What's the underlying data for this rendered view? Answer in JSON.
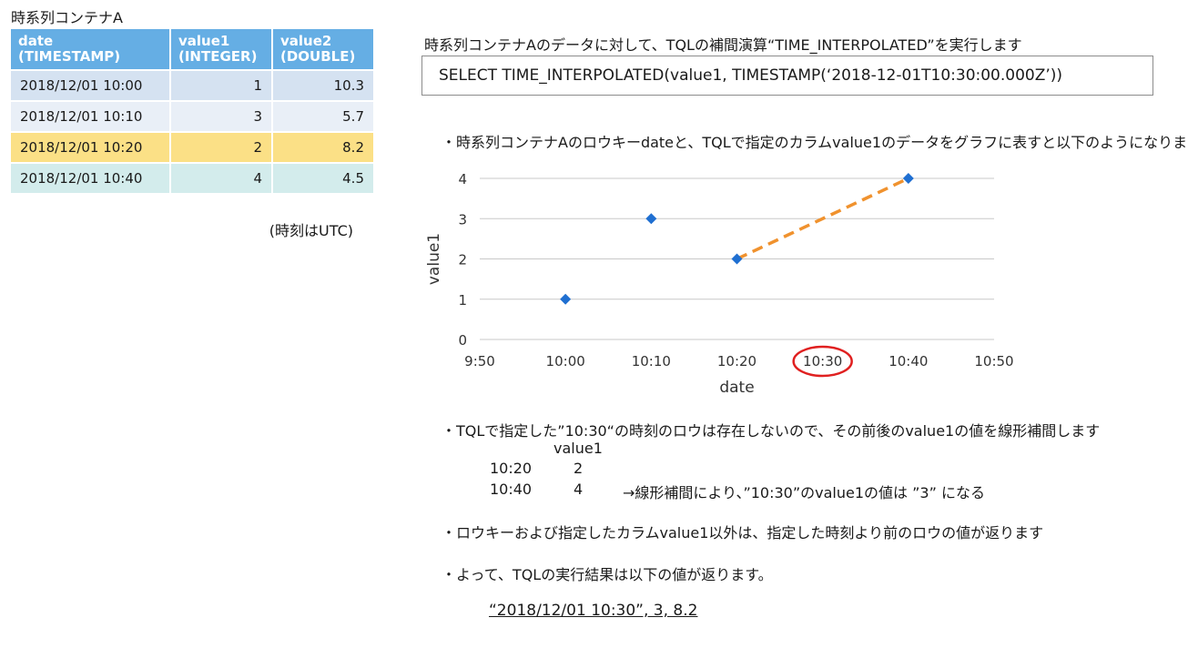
{
  "container": {
    "title": "時系列コンテナA",
    "columns": [
      {
        "name": "date",
        "type": "(TIMESTAMP)"
      },
      {
        "name": "value1",
        "type": "(INTEGER)"
      },
      {
        "name": "value2",
        "type": "(DOUBLE)"
      }
    ],
    "rows": [
      [
        "2018/12/01 10:00",
        "1",
        "10.3"
      ],
      [
        "2018/12/01 10:10",
        "3",
        "5.7"
      ],
      [
        "2018/12/01 10:20",
        "2",
        "8.2"
      ],
      [
        "2018/12/01 10:40",
        "4",
        "4.5"
      ]
    ],
    "timezone_note": "(時刻はUTC)"
  },
  "intro_text": "時系列コンテナAのデータに対して、TQLの補間演算“TIME_INTERPOLATED”を実行します",
  "query": "SELECT TIME_INTERPOLATED(value1, TIMESTAMP(‘2018-12-01T10:30:00.000Z’))",
  "bullets": {
    "graph": "・時系列コンテナAのロウキーdateと、TQLで指定のカラムvalue1のデータをグラフに表すと以下のようになります",
    "missing": "・TQLで指定した”10:30“の時刻のロウは存在しないので、その前後のvalue1の値を線形補間します",
    "others": "・ロウキーおよび指定したカラムvalue1以外は、指定した時刻より前のロウの値が返ります",
    "result": "・よって、TQLの実行結果は以下の値が返ります。"
  },
  "interpolation": {
    "header": "value1",
    "rows": [
      {
        "time": "10:20",
        "value": "2"
      },
      {
        "time": "10:40",
        "value": "4"
      }
    ],
    "note": "→線形補間により、”10:30”のvalue1の値は ”3” になる"
  },
  "result_value": "“2018/12/01 10:30”, 3, 8.2",
  "chart_data": {
    "type": "scatter",
    "xlabel": "date",
    "ylabel": "value1",
    "x_ticks": [
      "9:50",
      "10:00",
      "10:10",
      "10:20",
      "10:30",
      "10:40",
      "10:50"
    ],
    "x_tick_minutes": [
      590,
      600,
      610,
      620,
      630,
      640,
      650
    ],
    "xlim": [
      590,
      650
    ],
    "y_ticks": [
      "0",
      "1",
      "2",
      "3",
      "4"
    ],
    "ylim": [
      0,
      4
    ],
    "points": [
      {
        "x": "10:00",
        "x_min": 600,
        "y": 1
      },
      {
        "x": "10:10",
        "x_min": 610,
        "y": 3
      },
      {
        "x": "10:20",
        "x_min": 620,
        "y": 2
      },
      {
        "x": "10:40",
        "x_min": 640,
        "y": 4
      }
    ],
    "interpolation_line": {
      "from": [
        620,
        2
      ],
      "to": [
        640,
        4
      ]
    },
    "highlight_tick": "10:30",
    "grid": true,
    "colors": {
      "marker": "#1f6fd1",
      "interp_line": "#f0922e",
      "highlight": "#e02020",
      "grid": "#c8c8c8"
    }
  }
}
